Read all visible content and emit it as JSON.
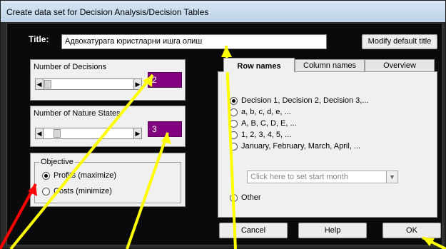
{
  "window": {
    "title": "Create data set for Decision Analysis/Decision Tables"
  },
  "title_field": {
    "label": "Title:",
    "value": "Адвокатурага юристларни ишга олиш"
  },
  "buttons": {
    "modify_title": "Modify default title",
    "cancel": "Cancel",
    "help": "Help",
    "ok": "OK"
  },
  "decisions": {
    "label": "Number of Decisions",
    "value": "2"
  },
  "nature_states": {
    "label": "Number of Nature States",
    "value": "3"
  },
  "objective": {
    "legend": "Objective",
    "options": [
      {
        "label": "Profits (maximize)",
        "selected": true
      },
      {
        "label": "Costs (minimize)",
        "selected": false
      }
    ]
  },
  "tabs": [
    {
      "label": "Row names",
      "active": true
    },
    {
      "label": "Column names",
      "active": false
    },
    {
      "label": "Overview",
      "active": false
    }
  ],
  "row_name_options": [
    {
      "label": "Decision 1, Decision 2, Decision 3,...",
      "selected": true
    },
    {
      "label": "a, b, c, d, e, ...",
      "selected": false
    },
    {
      "label": "A, B, C, D, E, ...",
      "selected": false
    },
    {
      "label": "1, 2, 3, 4, 5, ...",
      "selected": false
    },
    {
      "label": "January, February, March, April, ...",
      "selected": false
    }
  ],
  "month_combo": {
    "placeholder": "Click here to set start month"
  },
  "other_option": {
    "label": "Other",
    "selected": false
  },
  "colors": {
    "value_box": "#800080",
    "annotation_arrow": "#ffff00",
    "annotation_arrow_red": "#ff0000"
  }
}
